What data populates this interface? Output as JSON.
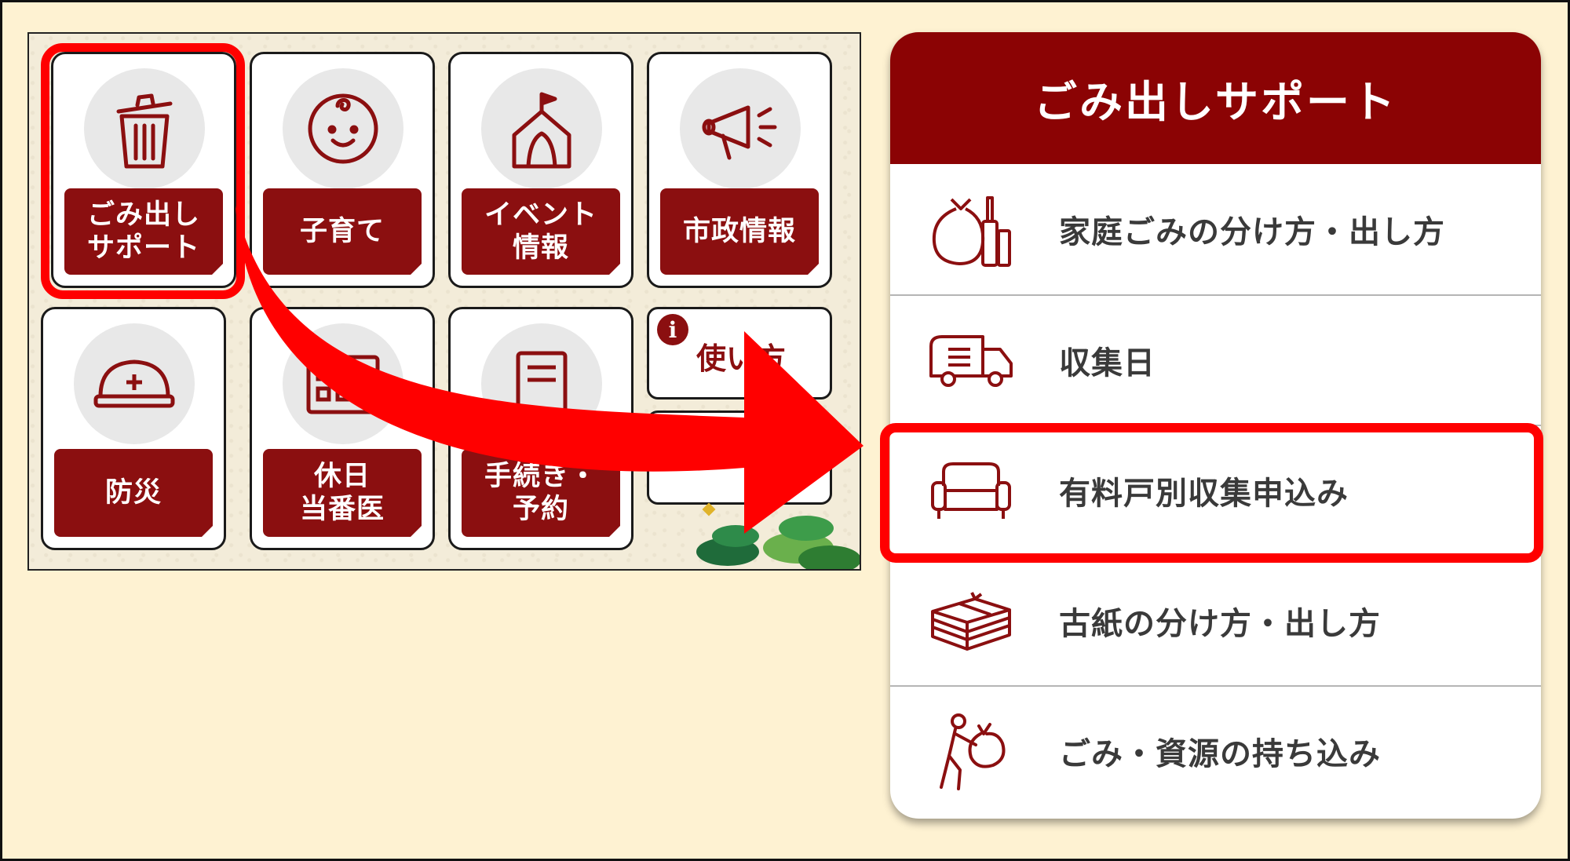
{
  "tiles": [
    {
      "label": "ごみ出し\nサポート",
      "icon": "trash-can-icon"
    },
    {
      "label": "子育て",
      "icon": "baby-face-icon"
    },
    {
      "label": "イベント\n情報",
      "icon": "tent-flag-icon"
    },
    {
      "label": "市政情報",
      "icon": "megaphone-icon"
    },
    {
      "label": "防災",
      "icon": "helmet-icon"
    },
    {
      "label": "休日\n当番医",
      "icon": "calendar-icon"
    },
    {
      "label": "手続き・\n予約",
      "icon": "document-icon"
    }
  ],
  "usage_tile": {
    "label": "使い方",
    "icon": "info-icon"
  },
  "panel": {
    "title": "ごみ出しサポート",
    "items": [
      {
        "label": "家庭ごみの分け方・出し方",
        "icon": "garbage-bag-bottles-icon"
      },
      {
        "label": "収集日",
        "icon": "garbage-truck-icon"
      },
      {
        "label": "有料戸別収集申込み",
        "icon": "sofa-icon"
      },
      {
        "label": "古紙の分け方・出し方",
        "icon": "paper-bundle-icon"
      },
      {
        "label": "ごみ・資源の持ち込み",
        "icon": "person-carrying-bag-icon"
      }
    ]
  },
  "colors": {
    "accent": "#8b0304",
    "highlight": "#ff0000",
    "background": "#fef2d2"
  }
}
